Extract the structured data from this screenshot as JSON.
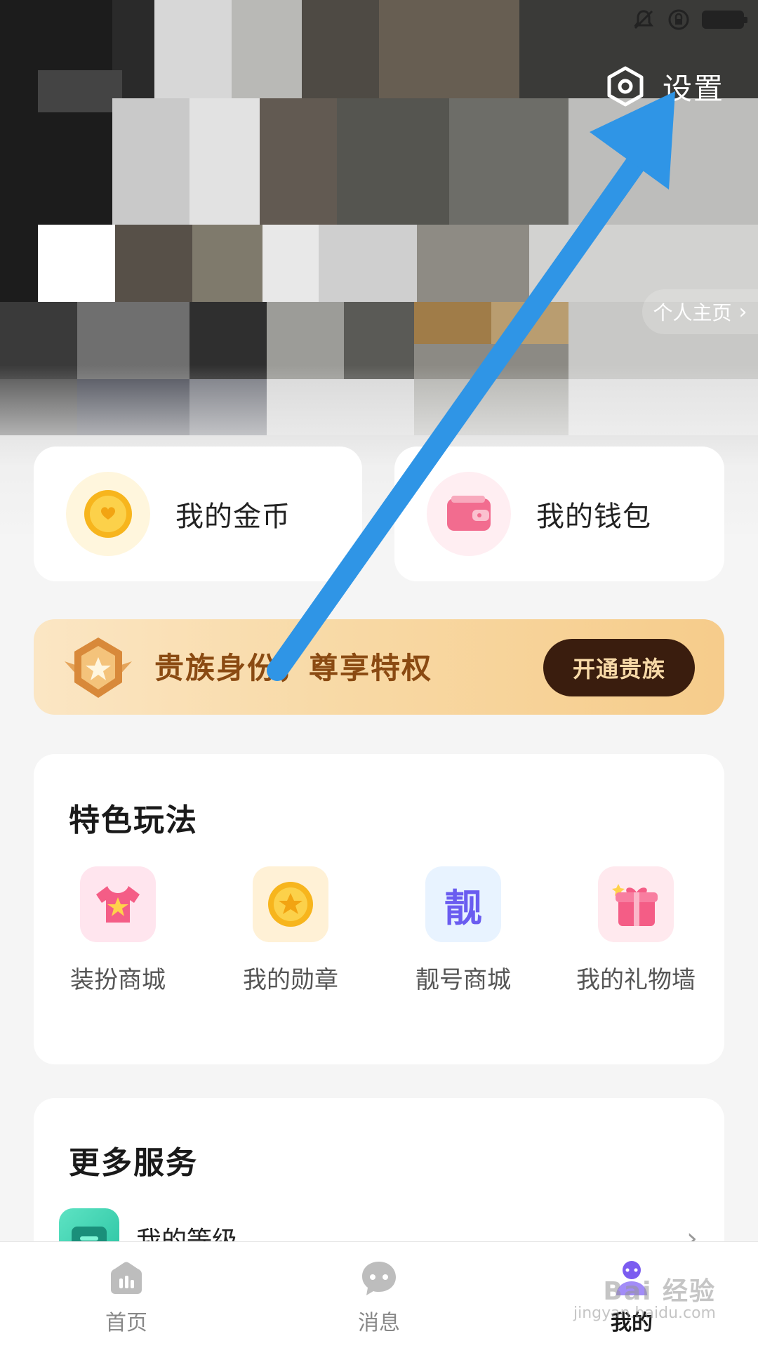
{
  "status_bar": {
    "icons": [
      "bell-muted-icon",
      "rotation-lock-icon",
      "battery-icon"
    ]
  },
  "header": {
    "settings_label": "设置",
    "profile_link_label": "个人主页"
  },
  "quick_cards": [
    {
      "label": "我的金币",
      "icon": "gold-coin-icon"
    },
    {
      "label": "我的钱包",
      "icon": "wallet-icon"
    }
  ],
  "noble_banner": {
    "text": "贵族身份，尊享特权",
    "button_label": "开通贵族"
  },
  "features": {
    "title": "特色玩法",
    "items": [
      {
        "label": "装扮商城",
        "icon": "outfit-shop-icon"
      },
      {
        "label": "我的勋章",
        "icon": "medal-icon"
      },
      {
        "label": "靓号商城",
        "icon": "premium-id-icon",
        "glyph": "靓"
      },
      {
        "label": "我的礼物墙",
        "icon": "gift-wall-icon"
      }
    ]
  },
  "services": {
    "title": "更多服务",
    "items": [
      {
        "label": "我的等级",
        "icon": "level-icon"
      }
    ]
  },
  "tabbar": {
    "items": [
      {
        "label": "首页",
        "icon": "home-icon",
        "active": false
      },
      {
        "label": "消息",
        "icon": "message-icon",
        "active": false
      },
      {
        "label": "我的",
        "icon": "profile-icon",
        "active": true
      }
    ]
  },
  "watermark": {
    "brand": "Bai 经验",
    "url": "jingyan.baidu.com"
  },
  "colors": {
    "annotation_arrow": "#2f95e6",
    "noble_text": "#8a4a12",
    "noble_button_bg": "#3a1d0e"
  }
}
